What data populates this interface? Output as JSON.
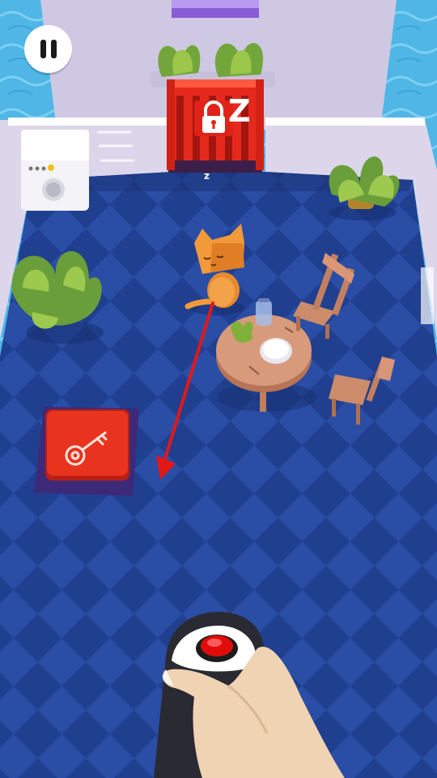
{
  "hud": {
    "pause_icon": "pause-icon"
  },
  "gate": {
    "lock_icon": "padlock-icon",
    "sleep_text_large": "Z",
    "sleep_text_small": "z"
  },
  "floor_button": {
    "icon": "key-icon",
    "color": "#e8331f"
  },
  "remote": {
    "button_color": "#e00c0c"
  },
  "aim_line": {
    "color": "#e21818"
  },
  "colors": {
    "water": "#4fb6e6",
    "floor_dark": "#1f3f8e",
    "floor_light": "#2a4ea3",
    "walls": "#d9d2e8",
    "gate_red": "#e52a1d",
    "cat_orange": "#f29a3a"
  }
}
